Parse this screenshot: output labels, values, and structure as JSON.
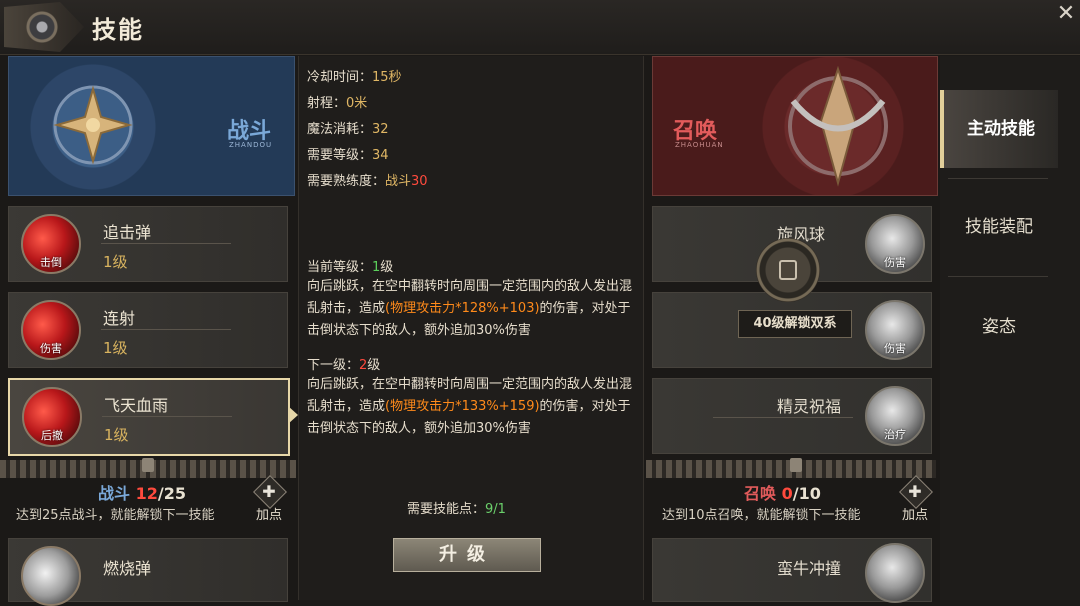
{
  "header": {
    "title": "技能",
    "close_glyph": "✕"
  },
  "left_school": {
    "name": "战斗",
    "sub": "ZHANDOU",
    "skills": [
      {
        "name": "追击弹",
        "level": "1级",
        "tag": "击倒"
      },
      {
        "name": "连射",
        "level": "1级",
        "tag": "伤害"
      },
      {
        "name": "飞天血雨",
        "level": "1级",
        "tag": "后撤"
      },
      {
        "name": "燃烧弹"
      }
    ],
    "progress": {
      "label": "战斗",
      "current": "12",
      "total": "/25"
    },
    "unlock_hint": "达到25点战斗，就能解锁下一技能",
    "add_label": "加点"
  },
  "details": {
    "cooldown_label": "冷却时间：",
    "cooldown_value": "15秒",
    "range_label": "射程：",
    "range_value": "0米",
    "mana_label": "魔法消耗：",
    "mana_value": "32",
    "req_level_label": "需要等级：",
    "req_level_value": "34",
    "req_prof_label": "需要熟练度：",
    "req_prof_school": "战斗",
    "req_prof_value": "30",
    "current_label": "当前等级：",
    "current_value": "1",
    "current_suffix": "级",
    "current_desc_a": "向后跳跃，在空中翻转时向周围一定范围内的敌人发出混乱射击，造成",
    "current_desc_hl": "(物理攻击力*128%+103)",
    "current_desc_b": "的伤害，对处于击倒状态下的敌人，额外追加30%伤害",
    "next_label": "下一级：",
    "next_value": "2",
    "next_suffix": "级",
    "next_desc_a": "向后跳跃，在空中翻转时向周围一定范围内的敌人发出混乱射击，造成",
    "next_desc_hl": "(物理攻击力*133%+159)",
    "next_desc_b": "的伤害，对处于击倒状态下的敌人，额外追加30%伤害",
    "cost_label": "需要技能点：",
    "cost_value": "9/1",
    "upgrade_label": "升级"
  },
  "right_school": {
    "name": "召唤",
    "sub": "ZHAOHUAN",
    "skills": [
      {
        "name": "旋风球",
        "tag": "伤害"
      },
      {
        "name": "",
        "tag": "伤害"
      },
      {
        "name": "精灵祝福",
        "tag": "治疗"
      },
      {
        "name": "蛮牛冲撞"
      }
    ],
    "lock_text": "40级解锁双系",
    "progress": {
      "label": "召唤",
      "current": "0",
      "total": "/10"
    },
    "unlock_hint": "达到10点召唤，就能解锁下一技能",
    "add_label": "加点"
  },
  "tabs": [
    {
      "label": "主动技能",
      "active": true
    },
    {
      "label": "技能装配",
      "active": false
    },
    {
      "label": "姿态",
      "active": false
    }
  ],
  "colors": {
    "accent_gold": "#e0b765",
    "highlight_orange": "#ff8a1a",
    "red": "#ff4a3d",
    "green": "#5bd05b"
  }
}
